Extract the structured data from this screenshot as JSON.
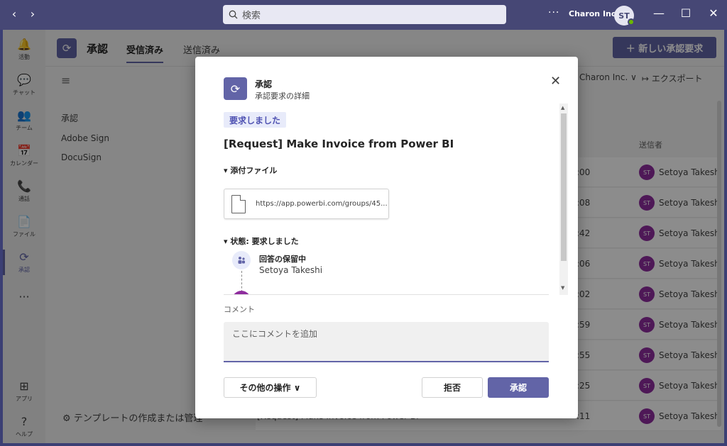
{
  "titlebar": {
    "back": "‹",
    "forward": "›",
    "search_placeholder": "検索",
    "more": "···",
    "org_name": "Charon Inc.",
    "avatar_initials": "ST"
  },
  "rail": {
    "items": [
      {
        "label": "活動",
        "icon": "🔔"
      },
      {
        "label": "チャット",
        "icon": "💬"
      },
      {
        "label": "チーム",
        "icon": "👥"
      },
      {
        "label": "カレンダー",
        "icon": "📅"
      },
      {
        "label": "通話",
        "icon": "📞"
      },
      {
        "label": "ファイル",
        "icon": "📄"
      },
      {
        "label": "承認",
        "icon": "⟳"
      },
      {
        "label": "",
        "icon": "···"
      },
      {
        "label": "アプリ",
        "icon": "⊞"
      },
      {
        "label": "ヘルプ",
        "icon": "?"
      }
    ]
  },
  "app": {
    "title": "承認",
    "tabs": [
      "受信済み",
      "送信済み"
    ],
    "new_request": "＋ 新しい承認要求",
    "side_items": [
      "承認",
      "Adobe Sign",
      "DocuSign"
    ],
    "template_link": "⚙ テンプレートの作成または管理",
    "filter": "Charon Inc. ∨",
    "export": "↦ エクスポート",
    "sender_header": "送信者",
    "rows": [
      {
        "time": ":00",
        "initials": "ST",
        "sender": "Setoya Takeshi"
      },
      {
        "time": ":08",
        "initials": "ST",
        "sender": "Setoya Takeshi"
      },
      {
        "time": ":42",
        "initials": "ST",
        "sender": "Setoya Takeshi"
      },
      {
        "time": ":06",
        "initials": "ST",
        "sender": "Setoya Takeshi"
      },
      {
        "time": ":02",
        "initials": "ST",
        "sender": "Setoya Takeshi"
      },
      {
        "time": ":59",
        "initials": "ST",
        "sender": "Setoya Takeshi"
      },
      {
        "time": ":55",
        "initials": "ST",
        "sender": "Setoya Takeshi"
      },
      {
        "time": ":25",
        "initials": "ST",
        "sender": "Setoya Takeshi"
      },
      {
        "time": ":11",
        "initials": "ST",
        "sender": "Setoya Takeshi"
      }
    ],
    "last_row_title": "[Request] Make Invoice from Power BI"
  },
  "dialog": {
    "app_name": "承認",
    "subtitle": "承認要求の詳細",
    "status_badge": "要求しました",
    "request_title": "[Request] Make Invoice from Power BI",
    "attachments_label": "▾ 添付ファイル",
    "attachment_url": "https://app.powerbi.com/groups/45...",
    "status_section": "▾ 状態: 要求しました",
    "timeline_status": "回答の保留中",
    "timeline_person": "Setoya Takeshi",
    "comment_label": "コメント",
    "comment_placeholder": "ここにコメントを追加",
    "more_actions": "その他の操作 ∨",
    "reject": "拒否",
    "approve": "承認"
  },
  "colors": {
    "brand": "#6264a7",
    "titlebar": "#464775",
    "avatar": "#8f2d9e"
  }
}
